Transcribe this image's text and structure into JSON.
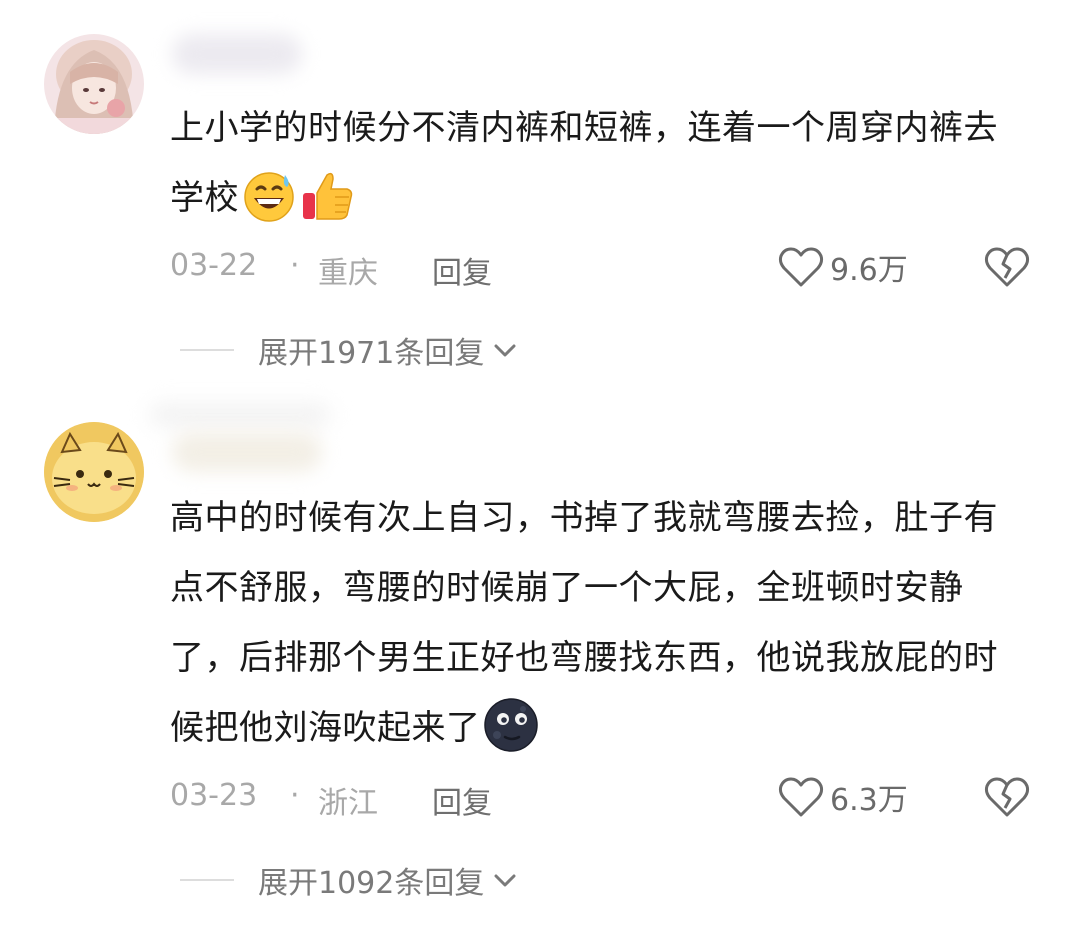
{
  "comments": [
    {
      "text": "上小学的时候分不清内裤和短裤，连着一个周穿内裤去学校",
      "emojis": [
        "grinning-sweat-face",
        "thumbs-up"
      ],
      "date": "03-22",
      "location": "重庆",
      "reply_label": "回复",
      "likes": "9.6万",
      "expand_label": "展开1971条回复"
    },
    {
      "text": "高中的时候有次上自习，书掉了我就弯腰去捡，肚子有点不舒服，弯腰的时候崩了一个大屁，全班顿时安静了，后排那个男生正好也弯腰找东西，他说我放屁的时候把他刘海吹起来了",
      "emojis": [
        "new-moon-face"
      ],
      "date": "03-23",
      "location": "浙江",
      "reply_label": "回复",
      "likes": "6.3万",
      "expand_label": "展开1092条回复"
    }
  ],
  "meta_separator": "·",
  "colors": {
    "text": "#1a1a1a",
    "meta": "#a8a8a8",
    "reply": "#6f6f6f",
    "expand": "#7a7a7a"
  }
}
